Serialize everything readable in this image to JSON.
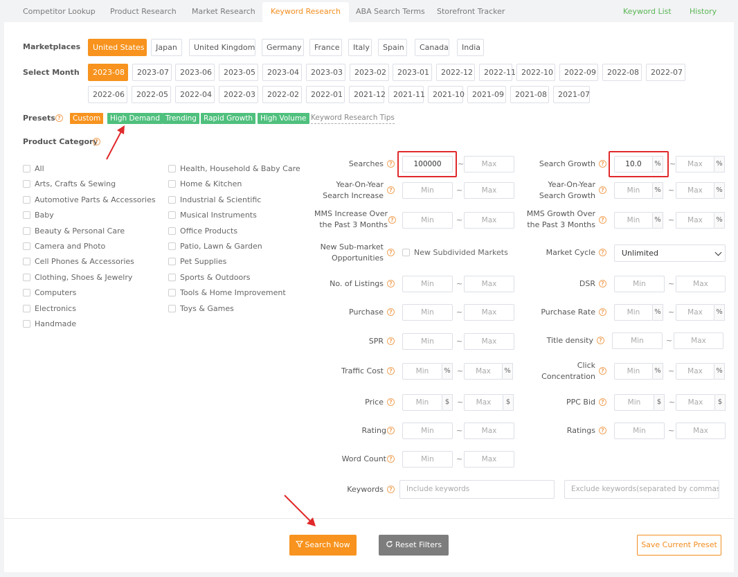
{
  "nav": {
    "tabs": [
      "Competitor Lookup",
      "Product Research",
      "Market Research",
      "Keyword Research",
      "ABA Search Terms",
      "Storefront Tracker"
    ],
    "right_links": [
      "Keyword List",
      "History"
    ]
  },
  "marketplaces": {
    "label": "Marketplaces",
    "items": [
      "United States",
      "Japan",
      "United Kingdom",
      "Germany",
      "France",
      "Italy",
      "Spain",
      "Canada",
      "India"
    ],
    "selected": "United States"
  },
  "month": {
    "label": "Select Month",
    "items": [
      "2023-08",
      "2023-07",
      "2023-06",
      "2023-05",
      "2023-04",
      "2023-03",
      "2023-02",
      "2023-01",
      "2022-12",
      "2022-11",
      "2022-10",
      "2022-09",
      "2022-08",
      "2022-07",
      "2022-06",
      "2022-05",
      "2022-04",
      "2022-03",
      "2022-02",
      "2022-01",
      "2021-12",
      "2021-11",
      "2021-10",
      "2021-09",
      "2021-08",
      "2021-07"
    ],
    "selected": "2023-08"
  },
  "presets": {
    "label": "Presets",
    "items": [
      "Custom",
      "High Demand",
      "Trending",
      "Rapid Growth",
      "High Volume"
    ],
    "tips": "Keyword Research Tips"
  },
  "category": {
    "label": "Product Category",
    "col1": [
      "All",
      "Arts, Crafts & Sewing",
      "Automotive Parts & Accessories",
      "Baby",
      "Beauty & Personal Care",
      "Camera and Photo",
      "Cell Phones & Accessories",
      "Clothing, Shoes & Jewelry",
      "Computers",
      "Electronics",
      "Handmade"
    ],
    "col2": [
      "Health, Household & Baby Care",
      "Home & Kitchen",
      "Industrial & Scientific",
      "Musical Instruments",
      "Office Products",
      "Patio, Lawn & Garden",
      "Pet Supplies",
      "Sports & Outdoors",
      "Tools & Home Improvement",
      "Toys & Games"
    ]
  },
  "filters": {
    "min": "Min",
    "max": "Max",
    "pct": "%",
    "dollar": "$",
    "tilde": "~",
    "searches": {
      "label": "Searches",
      "min_value": "100000"
    },
    "yoy_search": {
      "line1": "Year-On-Year",
      "line2": "Search Increase"
    },
    "mms_increase": {
      "line1": "MMS Increase Over",
      "line2": "the Past 3 Months"
    },
    "new_submarket": {
      "line1": "New Sub-market",
      "line2": "Opportunities",
      "checkbox": "New Subdivided Markets"
    },
    "listings": {
      "label": "No. of Listings"
    },
    "purchase": {
      "label": "Purchase"
    },
    "spr": {
      "label": "SPR"
    },
    "traffic_cost": {
      "label": "Traffic Cost"
    },
    "price": {
      "label": "Price"
    },
    "rating": {
      "label": "Rating"
    },
    "word_count": {
      "label": "Word Count"
    },
    "search_growth": {
      "label": "Search Growth",
      "min_value": "10.0"
    },
    "yoy_growth": {
      "line1": "Year-On-Year",
      "line2": "Search Growth"
    },
    "mms_growth": {
      "line1": "MMS Growth Over",
      "line2": "the Past 3 Months"
    },
    "market_cycle": {
      "label": "Market Cycle",
      "value": "Unlimited"
    },
    "dsr": {
      "label": "DSR"
    },
    "purchase_rate": {
      "label": "Purchase Rate"
    },
    "title_density": {
      "label": "Title density"
    },
    "click_conc": {
      "line1": "Click",
      "line2": "Concentration"
    },
    "ppc_bid": {
      "label": "PPC Bid"
    },
    "ratings": {
      "label": "Ratings"
    },
    "keywords": {
      "label": "Keywords",
      "include_placeholder": "Include keywords",
      "exclude_placeholder": "Exclude keywords(separated by commas)"
    }
  },
  "actions": {
    "search": "Search Now",
    "reset": "Reset Filters",
    "save": "Save Current Preset"
  },
  "colors": {
    "accent": "#f7931e",
    "preset_green": "#4fc07d",
    "highlight": "#e0292b"
  }
}
